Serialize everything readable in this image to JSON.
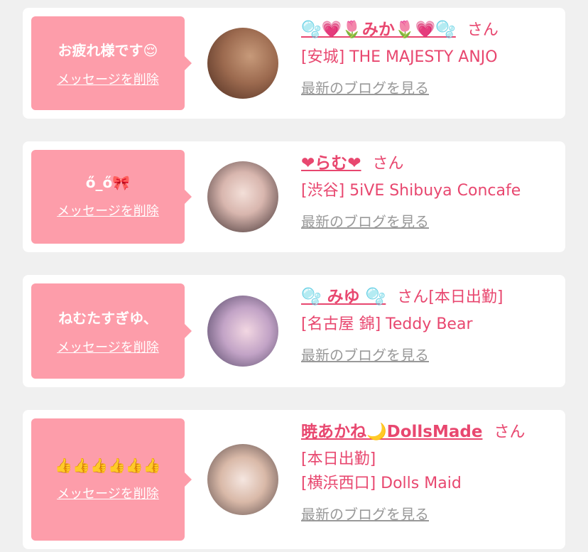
{
  "colors": {
    "accent": "#e8476f",
    "bubble": "#fd9daa",
    "link_gray": "#999999",
    "page_bg": "#f0f0f0"
  },
  "entries": [
    {
      "message": "お疲れ様です😌",
      "delete_label": "メッセージを削除",
      "name": "🫧💗🌷みか🌷💗🫧",
      "honorific": "さん",
      "extra": "",
      "lines": [
        "[安城] THE MAJESTY ANJO"
      ],
      "blog_label": "最新のブログを見る",
      "avatar": "avatar-photo"
    },
    {
      "message": "ő_ő🎀",
      "delete_label": "メッセージを削除",
      "name": "❤らむ❤",
      "honorific": "さん",
      "extra": "",
      "lines": [
        "[渋谷] 5iVE Shibuya Concafe"
      ],
      "blog_label": "最新のブログを見る",
      "avatar": "avatar-photo"
    },
    {
      "message": "ねむたすぎゆ、",
      "delete_label": "メッセージを削除",
      "name": "🫧 みゆ 🫧",
      "honorific": "さん",
      "extra": "[本日出勤]",
      "lines": [
        "[名古屋 錦] Teddy Bear"
      ],
      "blog_label": "最新のブログを見る",
      "avatar": "avatar-photo"
    },
    {
      "message": "👍👍👍👍👍👍",
      "delete_label": "メッセージを削除",
      "name": "暁あかね🌙DollsMade",
      "honorific": "さん",
      "extra": "",
      "lines": [
        "[本日出勤]",
        "[横浜西口] Dolls Maid"
      ],
      "blog_label": "最新のブログを見る",
      "avatar": "avatar-photo"
    }
  ]
}
